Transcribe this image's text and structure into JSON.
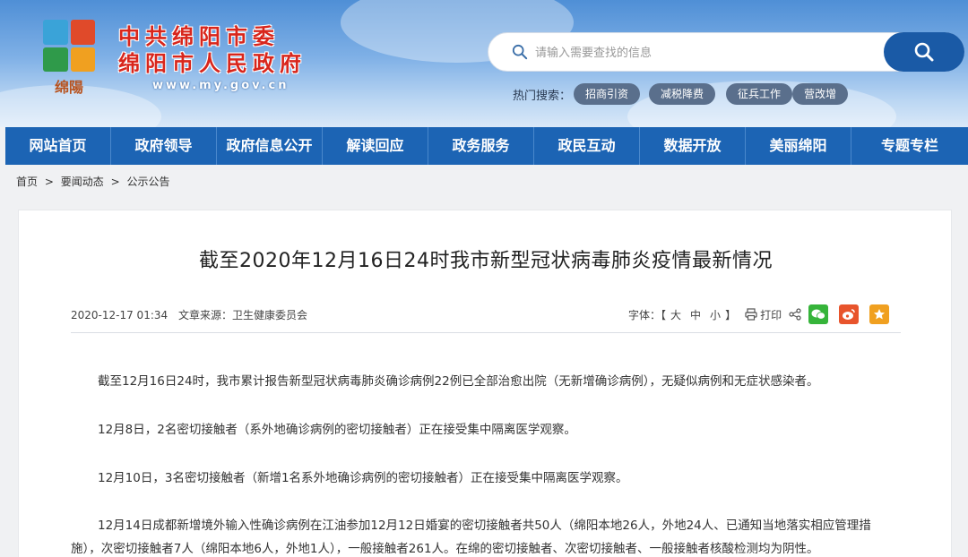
{
  "header": {
    "title_line1": "中共绵阳市委",
    "title_line2": "绵阳市人民政府",
    "url": "www.my.gov.cn",
    "logo_text": "绵陽",
    "search": {
      "placeholder": "请输入需要查找的信息"
    },
    "hot_label": "热门搜索：",
    "hot_tags": [
      "招商引资",
      "减税降费",
      "征兵工作",
      "营改增"
    ]
  },
  "nav": {
    "items": [
      "网站首页",
      "政府领导",
      "政府信息公开",
      "解读回应",
      "政务服务",
      "政民互动",
      "数据开放",
      "美丽绵阳",
      "专题专栏"
    ]
  },
  "breadcrumb": {
    "home": "首页",
    "sep": ">",
    "level1": "要闻动态",
    "level2": "公示公告"
  },
  "article": {
    "title": "截至2020年12月16日24时我市新型冠状病毒肺炎疫情最新情况",
    "date": "2020-12-17 01:34",
    "source_label": "文章来源：",
    "source": "卫生健康委员会",
    "font_label": "字体：【",
    "font_large": "大",
    "font_medium": "中",
    "font_small": "小",
    "font_end": "】",
    "print": "打印",
    "paragraphs": [
      "截至12月16日24时，我市累计报告新型冠状病毒肺炎确诊病例22例已全部治愈出院（无新增确诊病例），无疑似病例和无症状感染者。",
      "12月8日，2名密切接触者（系外地确诊病例的密切接触者）正在接受集中隔离医学观察。",
      "12月10日，3名密切接触者（新增1名系外地确诊病例的密切接触者）正在接受集中隔离医学观察。",
      "12月14日成都新增境外输入性确诊病例在江油参加12月12日婚宴的密切接触者共50人（绵阳本地26人，外地24人、已通知当地落实相应管理措施），次密切接触者7人（绵阳本地6人，外地1人），一般接触者261人。在绵的密切接触者、次密切接触者、一般接触者核酸检测均为阴性。"
    ]
  },
  "colors": {
    "nav_bg": "#1c64b4",
    "title_red": "#d8261c",
    "search_btn": "#1a5aa6"
  }
}
